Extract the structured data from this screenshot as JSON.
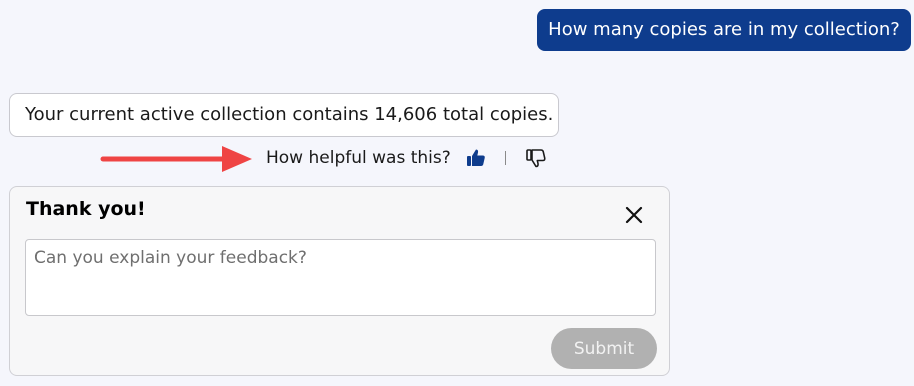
{
  "chat": {
    "user_message": "How many copies are in my collection?",
    "bot_message": "Your current active collection contains 14,606 total copies."
  },
  "feedback": {
    "question": "How helpful was this?",
    "thumbs_up_icon": "thumbs-up-icon",
    "thumbs_down_icon": "thumbs-down-icon",
    "thumbs_up_state": "selected"
  },
  "feedback_panel": {
    "title": "Thank you!",
    "close_icon": "close-icon",
    "textarea_placeholder": "Can you explain your feedback?",
    "textarea_value": "",
    "submit_label": "Submit",
    "submit_enabled": false
  },
  "annotation": {
    "arrow_icon": "arrow-right-icon",
    "arrow_color": "#ef4444"
  },
  "colors": {
    "background": "#f5f6fc",
    "user_bubble": "#0e3c8d",
    "accent": "#0e3c8d",
    "submit_disabled": "#b1b1b1"
  }
}
